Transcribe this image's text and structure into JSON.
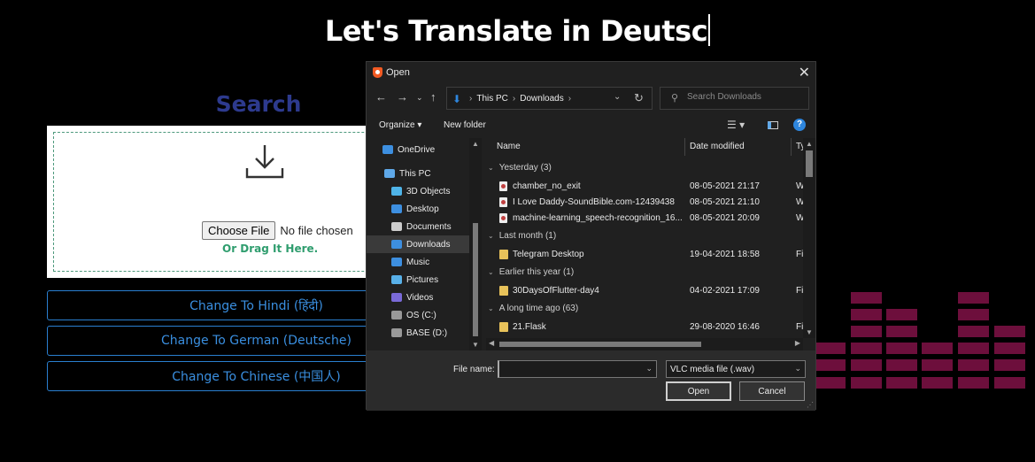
{
  "page": {
    "title": "Let's Translate in Deutsc",
    "search_heading": "Search",
    "upload": {
      "choose_file_label": "Choose File",
      "no_file_text": "No file chosen",
      "drag_text": "Or Drag It Here."
    },
    "language_buttons": [
      {
        "label": "Change To Hindi (हिंदी)"
      },
      {
        "label": "Change To German (Deutsche)"
      },
      {
        "label": "Change To Chinese (中国人)"
      }
    ],
    "colors": {
      "accent": "#2a7fd0",
      "heading": "#2d3a8e",
      "eq_bars": "#6d0f3c",
      "drag_text": "#2f9d6e"
    }
  },
  "dialog": {
    "title": "Open",
    "address": {
      "root": "This PC",
      "folder": "Downloads"
    },
    "search_placeholder": "Search Downloads",
    "toolbar": {
      "organize": "Organize ▾",
      "new_folder": "New folder"
    },
    "nav_items": [
      {
        "label": "OneDrive",
        "icon": "cloud-icon"
      },
      {
        "label": "This PC",
        "icon": "computer-icon"
      },
      {
        "label": "3D Objects",
        "icon": "cube-icon"
      },
      {
        "label": "Desktop",
        "icon": "desktop-icon"
      },
      {
        "label": "Documents",
        "icon": "documents-icon"
      },
      {
        "label": "Downloads",
        "icon": "download-icon"
      },
      {
        "label": "Music",
        "icon": "music-icon"
      },
      {
        "label": "Pictures",
        "icon": "pictures-icon"
      },
      {
        "label": "Videos",
        "icon": "videos-icon"
      },
      {
        "label": "OS (C:)",
        "icon": "drive-icon"
      },
      {
        "label": "BASE (D:)",
        "icon": "drive-icon"
      }
    ],
    "selected_nav": "Downloads",
    "columns": {
      "name": "Name",
      "date": "Date modified",
      "type": "Ty"
    },
    "groups": [
      {
        "label": "Yesterday (3)",
        "files": [
          {
            "name": "chamber_no_exit",
            "date": "08-05-2021 21:17",
            "type": "W",
            "kind": "media"
          },
          {
            "name": "I Love Daddy-SoundBible.com-12439438",
            "date": "08-05-2021 21:10",
            "type": "W",
            "kind": "media"
          },
          {
            "name": "machine-learning_speech-recognition_16...",
            "date": "08-05-2021 20:09",
            "type": "W",
            "kind": "media"
          }
        ]
      },
      {
        "label": "Last month (1)",
        "files": [
          {
            "name": "Telegram Desktop",
            "date": "19-04-2021 18:58",
            "type": "Fil",
            "kind": "folder"
          }
        ]
      },
      {
        "label": "Earlier this year (1)",
        "files": [
          {
            "name": "30DaysOfFlutter-day4",
            "date": "04-02-2021 17:09",
            "type": "Fil",
            "kind": "folder"
          }
        ]
      },
      {
        "label": "A long time ago (63)",
        "files": [
          {
            "name": "21.Flask",
            "date": "29-08-2020 16:46",
            "type": "Fil",
            "kind": "folder"
          }
        ]
      }
    ],
    "file_name_label": "File name:",
    "file_name_value": "",
    "file_type": "VLC media file (.wav)",
    "open_label": "Open",
    "cancel_label": "Cancel"
  }
}
